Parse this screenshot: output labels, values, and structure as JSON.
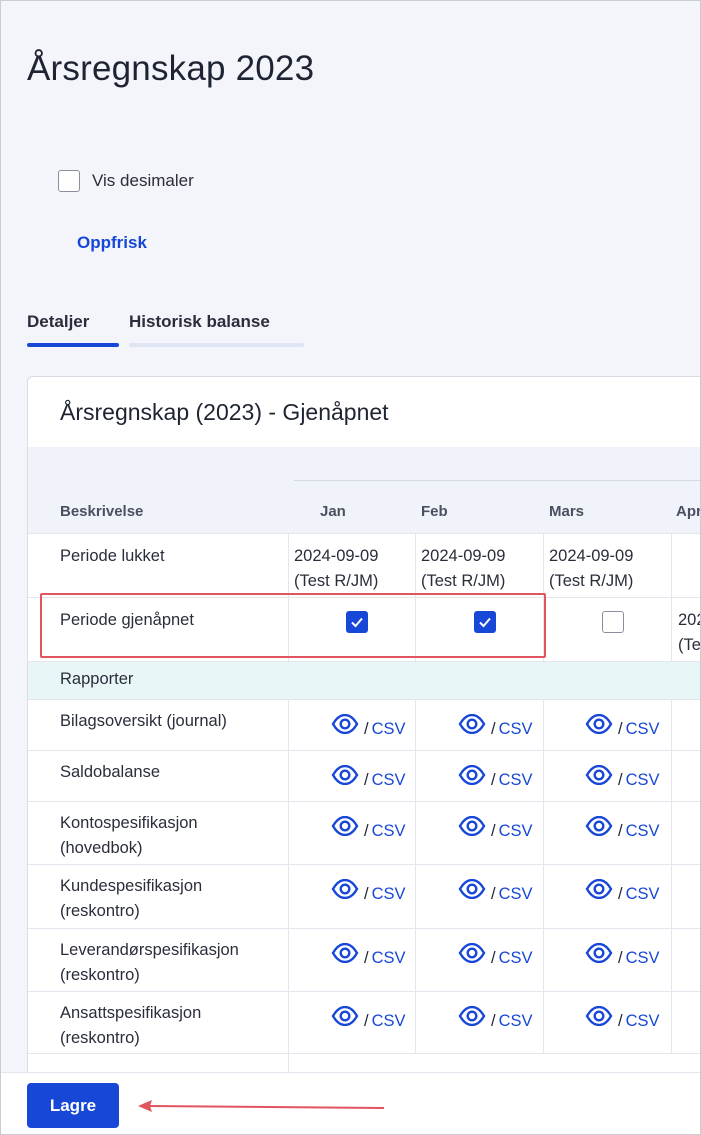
{
  "page": {
    "title": "Årsregnskap 2023",
    "show_decimals_label": "Vis desimaler",
    "show_decimals_checked": false,
    "refresh_label": "Oppfrisk",
    "tabs": [
      {
        "label": "Detaljer",
        "active": true
      },
      {
        "label": "Historisk balanse",
        "active": false
      }
    ]
  },
  "card": {
    "title": "Årsregnskap (2023) - Gjenåpnet",
    "columns": {
      "description": "Beskrivelse",
      "months": [
        "Jan",
        "Feb",
        "Mars",
        "Apr"
      ]
    },
    "period_closed": {
      "label": "Periode lukket",
      "cells": [
        {
          "date": "2024-09-09",
          "user": "(Test R/JM)"
        },
        {
          "date": "2024-09-09",
          "user": "(Test R/JM)"
        },
        {
          "date": "2024-09-09",
          "user": "(Test R/JM)"
        }
      ]
    },
    "period_reopened": {
      "label": "Periode gjenåpnet",
      "checked": [
        true,
        true,
        false
      ],
      "apr_partial_date": "202",
      "apr_partial_user": "(Te"
    },
    "section_reports": "Rapporter",
    "reports": [
      {
        "label_line1": "Bilagsoversikt (journal)",
        "label_line2": ""
      },
      {
        "label_line1": "Saldobalanse",
        "label_line2": ""
      },
      {
        "label_line1": "Kontospesifikasjon",
        "label_line2": "(hovedbok)"
      },
      {
        "label_line1": "Kundespesifikasjon",
        "label_line2": "(reskontro)"
      },
      {
        "label_line1": "Leverandørspesifikasjon",
        "label_line2": "(reskontro)"
      },
      {
        "label_line1": "Ansattspesifikasjon",
        "label_line2": "(reskontro)"
      }
    ],
    "link_separator": "/",
    "link_csv": "CSV"
  },
  "footer": {
    "save_label": "Lagre"
  },
  "colors": {
    "accent": "#1747d6",
    "highlight": "#e0555e",
    "section_bg": "#e9f6f8"
  }
}
